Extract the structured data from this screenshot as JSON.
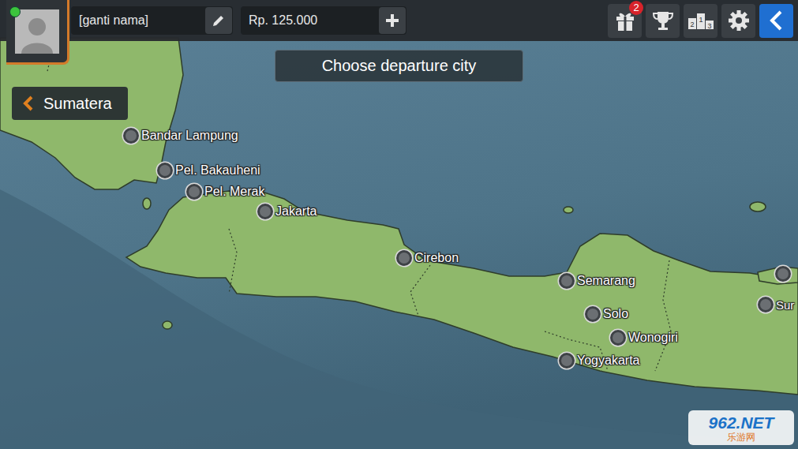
{
  "player": {
    "name": "[ganti nama]",
    "online": true,
    "money": "Rp. 125.000"
  },
  "toolbar": {
    "gift_badge": "2",
    "podium": [
      "2",
      "1",
      "3"
    ]
  },
  "title": "Choose departure city",
  "back_region": {
    "label": "Sumatera"
  },
  "cities": [
    {
      "label": "Bandar Lampung"
    },
    {
      "label": "Pel. Bakauheni"
    },
    {
      "label": "Pel. Merak"
    },
    {
      "label": "Jakarta"
    },
    {
      "label": "Cirebon"
    },
    {
      "label": "Semarang"
    },
    {
      "label": "Solo"
    },
    {
      "label": "Wonogiri"
    },
    {
      "label": "Yogyakarta"
    },
    {
      "label": "Sur"
    }
  ],
  "watermark": {
    "logo": "962.NET",
    "sub": "乐游网"
  }
}
